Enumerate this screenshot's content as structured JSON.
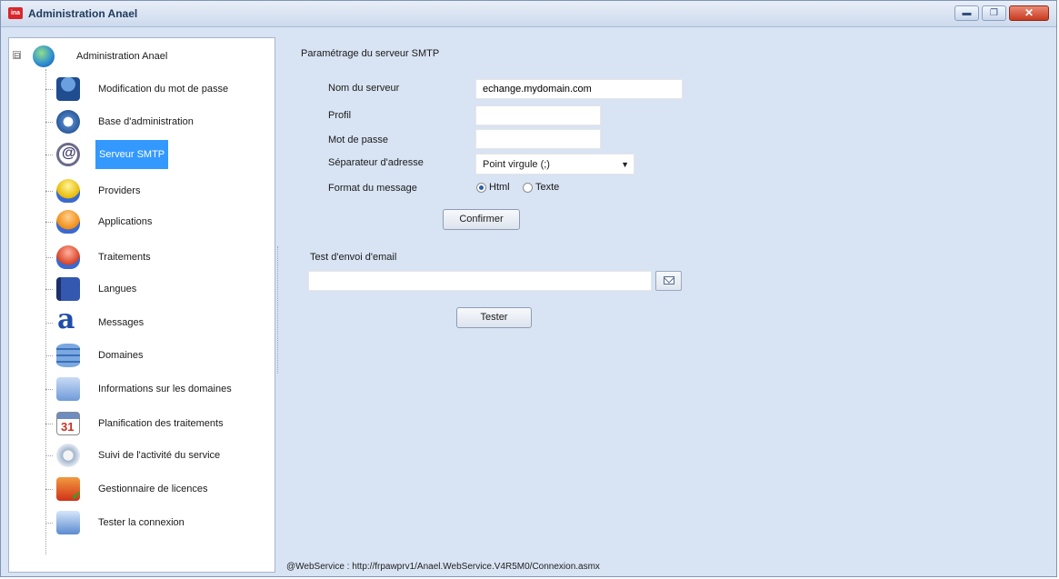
{
  "window": {
    "title": "Administration Anael",
    "app_icon": "anael-app-icon",
    "buttons": [
      "minimize",
      "maximize",
      "close"
    ],
    "close_glyph": "✕"
  },
  "tree": {
    "root": {
      "label": "Administration Anael",
      "icon": "globe-network-icon",
      "expander": "⊟"
    },
    "items": [
      {
        "label": "Modification du mot de passe",
        "icon": "user-key-icon"
      },
      {
        "label": "Base d'administration",
        "icon": "gear-database-icon"
      },
      {
        "label": "Serveur SMTP",
        "icon": "at-sign-icon",
        "selected": true
      },
      {
        "label": "Providers",
        "icon": "bulb-yellow-icon"
      },
      {
        "label": "Applications",
        "icon": "bulb-orange-icon"
      },
      {
        "label": "Traitements",
        "icon": "bulb-red-icon"
      },
      {
        "label": "Langues",
        "icon": "book-icon"
      },
      {
        "label": "Messages",
        "icon": "letter-a-icon"
      },
      {
        "label": "Domaines",
        "icon": "database-icon"
      },
      {
        "label": "Informations sur les domaines",
        "icon": "computers-icon"
      },
      {
        "label": "Planification des traitements",
        "icon": "calendar-icon"
      },
      {
        "label": "Suivi de l'activité du service",
        "icon": "service-gear-icon"
      },
      {
        "label": "Gestionnaire de licences",
        "icon": "license-check-icon"
      },
      {
        "label": "Tester la connexion",
        "icon": "network-computers-icon"
      }
    ]
  },
  "smtp": {
    "section_title": "Paramétrage du serveur SMTP",
    "server_label": "Nom du serveur",
    "server_value": "echange.mydomain.com",
    "profile_label": "Profil",
    "profile_value": "",
    "password_label": "Mot de passe",
    "password_value": "",
    "separator_label": "Séparateur d'adresse",
    "separator_value": "Point virgule (;)",
    "format_label": "Format du message",
    "format_options": [
      "Html",
      "Texte"
    ],
    "format_selected": "Html",
    "confirm_label": "Confirmer"
  },
  "test": {
    "section_title": "Test d'envoi d'email",
    "email_value": "",
    "test_label": "Tester"
  },
  "status": {
    "text": "@WebService : http://frpawprv1/Anael.WebService.V4R5M0/Connexion.asmx"
  },
  "colors": {
    "selection": "#3399ff",
    "window_bg": "#d8e3f3",
    "close_button": "#c83a1e"
  }
}
